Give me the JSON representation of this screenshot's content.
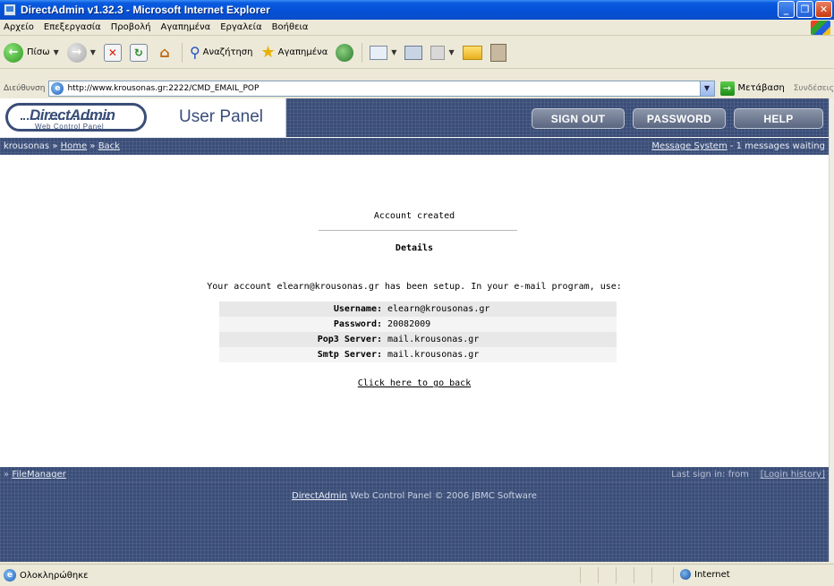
{
  "window": {
    "title": "DirectAdmin v1.32.3 - Microsoft Internet Explorer"
  },
  "menu": [
    "Αρχείο",
    "Επεξεργασία",
    "Προβολή",
    "Αγαπημένα",
    "Εργαλεία",
    "Βοήθεια"
  ],
  "toolbar": {
    "back_label": "Πίσω",
    "search_label": "Αναζήτηση",
    "favorites_label": "Αγαπημένα"
  },
  "address": {
    "label": "Διεύθυνση",
    "url": "http://www.krousonas.gr:2222/CMD_EMAIL_POP",
    "go_label": "Μετάβαση",
    "links_label": "Συνδέσεις"
  },
  "header": {
    "logo_text": "DirectAdmin",
    "logo_sub": "Web Control Panel",
    "panel_title": "User Panel",
    "nav": {
      "sign_out": "SIGN OUT",
      "password": "PASSWORD",
      "help": "HELP"
    }
  },
  "breadcrumb": {
    "user": "krousonas",
    "sep": "»",
    "home": "Home",
    "back": "Back",
    "message_link": "Message System",
    "message_text": " - 1 messages waiting"
  },
  "content": {
    "status": "Account created",
    "details_heading": "Details",
    "intro": "Your account elearn@krousonas.gr has been setup. In your e-mail program, use:",
    "rows": [
      {
        "key": "Username:",
        "value": "elearn@krousonas.gr"
      },
      {
        "key": "Password:",
        "value": "20082009"
      },
      {
        "key": "Pop3 Server:",
        "value": "mail.krousonas.gr"
      },
      {
        "key": "Smtp Server:",
        "value": "mail.krousonas.gr"
      }
    ],
    "back_link": "Click here to go back"
  },
  "footer": {
    "filemanager_prefix": "»",
    "filemanager": "FileManager",
    "last_sign_in": "Last sign in:   from",
    "login_history": "[Login history]",
    "copyright_link": "DirectAdmin",
    "copyright_text": " Web Control Panel © 2006 JBMC Software"
  },
  "status": {
    "text": "Ολοκληρώθηκε",
    "zone": "Internet"
  },
  "colors": {
    "da_navy": "#3a4e78",
    "xp_title_blue": "#0450d6"
  }
}
